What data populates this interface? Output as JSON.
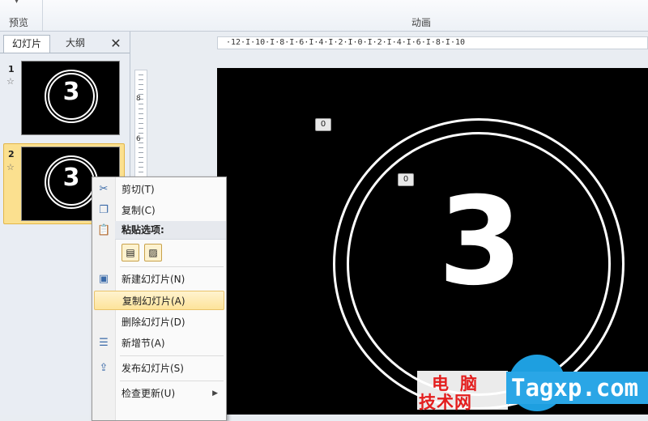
{
  "ribbon": {
    "preview_label": "预览",
    "animation_label": "动画"
  },
  "panel": {
    "tabs": [
      "幻灯片",
      "大纲"
    ],
    "close_glyph": "✕",
    "thumbs": [
      {
        "number": "1",
        "star": "☆",
        "content": "3"
      },
      {
        "number": "2",
        "star": "☆",
        "content": "3"
      }
    ]
  },
  "vruler": {
    "labels": [
      "8",
      "6"
    ]
  },
  "hruler": {
    "text": "·12·I·10·I·8·I·6·I·4·I·2·I·0·I·2·I·4·I·6·I·8·I·10"
  },
  "slide": {
    "number": "3",
    "anim_tags": [
      "0",
      "0"
    ]
  },
  "context_menu": {
    "items": [
      {
        "label": "剪切(T)",
        "icon": "scissors-icon",
        "glyph": "✂"
      },
      {
        "label": "复制(C)",
        "icon": "copy-icon",
        "glyph": "❐"
      },
      {
        "label": "粘贴选项:",
        "icon": "paste-icon",
        "glyph": "📋"
      },
      {
        "label": "新建幻灯片(N)",
        "icon": "new-slide-icon",
        "glyph": "▣"
      },
      {
        "label": "复制幻灯片(A)",
        "icon": "",
        "glyph": ""
      },
      {
        "label": "删除幻灯片(D)",
        "icon": "",
        "glyph": ""
      },
      {
        "label": "新增节(A)",
        "icon": "new-section-icon",
        "glyph": "☰"
      },
      {
        "label": "发布幻灯片(S)",
        "icon": "publish-slides-icon",
        "glyph": "⇪"
      },
      {
        "label": "检查更新(U)",
        "icon": "",
        "glyph": ""
      }
    ],
    "submenu_glyph": "▶"
  },
  "watermark": {
    "cn_line1": "电脑",
    "cn_line2": "技术网",
    "en": "Tagxp.com"
  }
}
